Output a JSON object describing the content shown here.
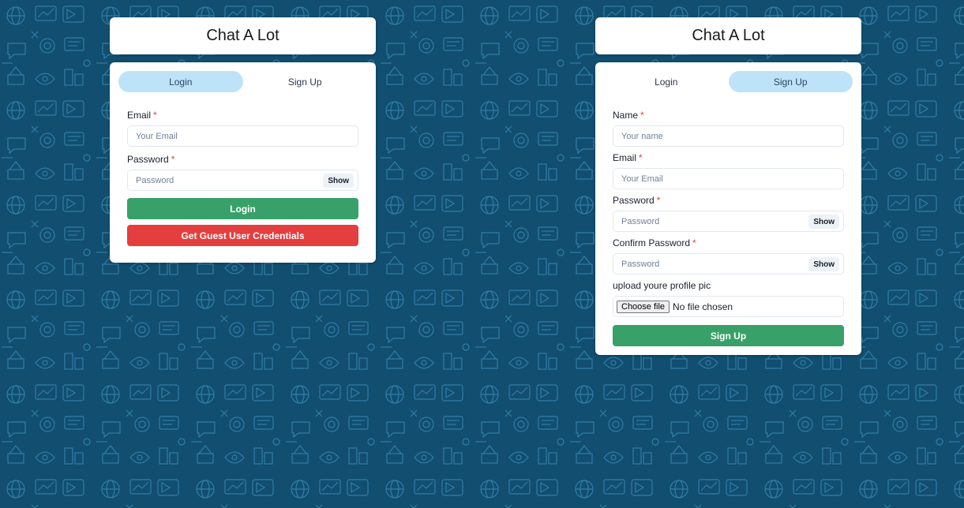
{
  "brand": {
    "title": "Chat A Lot"
  },
  "tabs": {
    "login": "Login",
    "signup": "Sign Up"
  },
  "login_form": {
    "email_label": "Email",
    "email_placeholder": "Your Email",
    "password_label": "Password",
    "password_placeholder": "Password",
    "show_label": "Show",
    "login_button": "Login",
    "guest_button": "Get Guest User Credentials"
  },
  "signup_form": {
    "name_label": "Name",
    "name_placeholder": "Your name",
    "email_label": "Email",
    "email_placeholder": "Your Email",
    "password_label": "Password",
    "password_placeholder": "Password",
    "confirm_label": "Confirm Password",
    "confirm_placeholder": "Password",
    "show_label": "Show",
    "pic_label": "upload youre profile pic",
    "choose_file": "Choose file",
    "no_file": "No file chosen",
    "signup_button": "Sign Up"
  },
  "required_mark": "*",
  "colors": {
    "background": "#114e70",
    "pattern": "#3a8cb5",
    "active_tab": "#bee3f8",
    "primary_green": "#38a169",
    "danger_red": "#e53e3e"
  }
}
